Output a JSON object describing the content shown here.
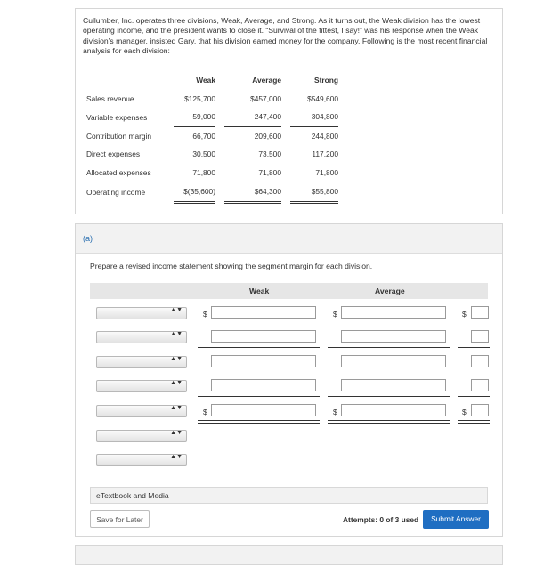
{
  "problem": {
    "text": "Cullumber, Inc. operates three divisions, Weak, Average, and Strong. As it turns out, the Weak division has the lowest operating income, and the president wants to close it. “Survival of the fittest, I say!” was his response when the Weak division’s manager, insisted Gary, that his division earned money for the company. Following is the most recent financial analysis for each division:",
    "columns": [
      "Weak",
      "Average",
      "Strong"
    ],
    "rows": [
      {
        "label": "Sales revenue",
        "values": [
          "$125,700",
          "$457,000",
          "$549,600"
        ]
      },
      {
        "label": "Variable expenses",
        "values": [
          "59,000",
          "247,400",
          "304,800"
        ]
      },
      {
        "label": "Contribution margin",
        "values": [
          "66,700",
          "209,600",
          "244,800"
        ]
      },
      {
        "label": "Direct expenses",
        "values": [
          "30,500",
          "73,500",
          "117,200"
        ]
      },
      {
        "label": "Allocated expenses",
        "values": [
          "71,800",
          "71,800",
          "71,800"
        ]
      },
      {
        "label": "Operating income",
        "values": [
          "$(35,600)",
          "$64,300",
          "$55,800"
        ]
      }
    ]
  },
  "part_a": {
    "label": "(a)",
    "prompt": "Prepare a revised income statement showing the segment margin for each division.",
    "col_weak": "Weak",
    "col_average": "Average",
    "currency": "$",
    "select_arrows": "▲▼"
  },
  "etextbook_label": "eTextbook and Media",
  "save_label": "Save for Later",
  "attempts_label": "Attempts: 0 of 3 used",
  "submit_label": "Submit Answer"
}
